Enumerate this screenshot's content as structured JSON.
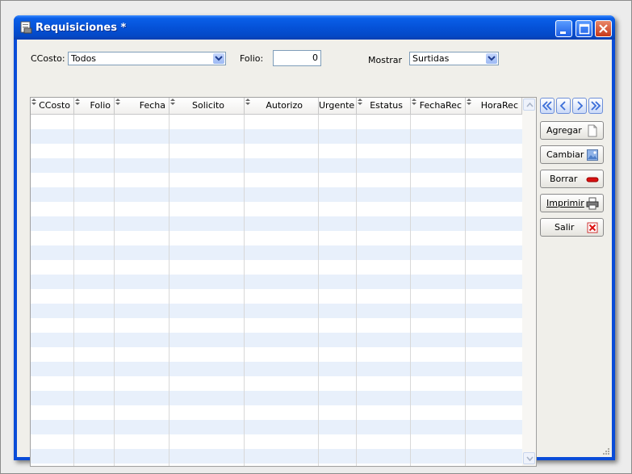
{
  "window": {
    "title": "Requisiciones *",
    "colors": {
      "title_bar": "#0552d8",
      "client_bg": "#f0efea",
      "row_alt": "#e8f0fb"
    }
  },
  "filters": {
    "ccosto_label": "CCosto:",
    "ccosto_value": "Todos",
    "folio_label": "Folio:",
    "folio_value": "0",
    "mostrar_label": "Mostrar",
    "mostrar_value": "Surtidas"
  },
  "grid": {
    "columns": [
      "CCosto",
      "Folio",
      "Fecha",
      "Solicito",
      "Autorizo",
      "Urgente",
      "Estatus",
      "FechaRec",
      "HoraRec"
    ],
    "rows": []
  },
  "navigation": {
    "icons": [
      "first-record-icon",
      "previous-record-icon",
      "next-record-icon",
      "last-record-icon"
    ]
  },
  "actions": {
    "agregar": {
      "label": "Agregar",
      "icon": "new-document-icon"
    },
    "cambiar": {
      "label": "Cambiar",
      "icon": "edit-picture-icon"
    },
    "borrar": {
      "label": "Borrar",
      "icon": "red-minus-icon"
    },
    "imprimir": {
      "label": "Imprimir",
      "icon": "printer-icon"
    },
    "salir": {
      "label": "Salir",
      "icon": "red-x-icon"
    }
  }
}
